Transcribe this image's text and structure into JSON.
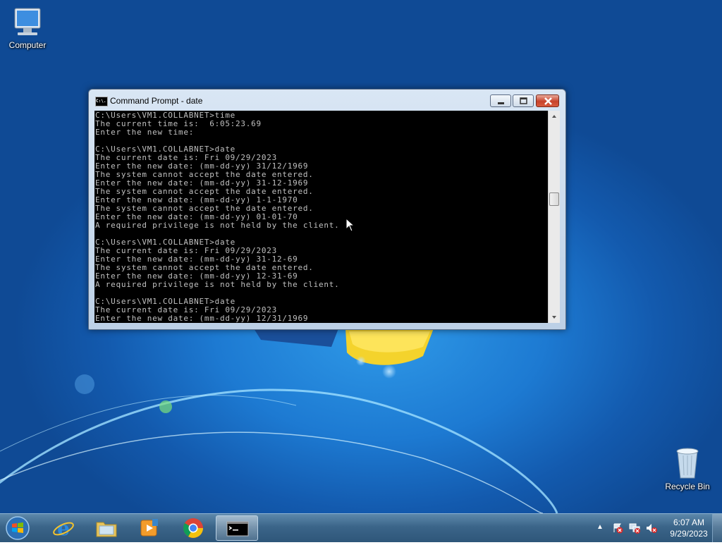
{
  "desktop": {
    "icons": [
      {
        "label": "Computer",
        "icon": "computer-icon"
      },
      {
        "label": "Recycle Bin",
        "icon": "recycle-bin-icon"
      }
    ]
  },
  "window": {
    "title": "Command Prompt - date",
    "icon": "cmd-icon",
    "icon_text": "C:\\.",
    "controls": [
      "minimize",
      "maximize",
      "close"
    ],
    "console_lines": [
      "C:\\Users\\VM1.COLLABNET>time",
      "The current time is:  6:05:23.69",
      "Enter the new time:",
      "",
      "C:\\Users\\VM1.COLLABNET>date",
      "The current date is: Fri 09/29/2023",
      "Enter the new date: (mm-dd-yy) 31/12/1969",
      "The system cannot accept the date entered.",
      "Enter the new date: (mm-dd-yy) 31-12-1969",
      "The system cannot accept the date entered.",
      "Enter the new date: (mm-dd-yy) 1-1-1970",
      "The system cannot accept the date entered.",
      "Enter the new date: (mm-dd-yy) 01-01-70",
      "A required privilege is not held by the client.",
      "",
      "C:\\Users\\VM1.COLLABNET>date",
      "The current date is: Fri 09/29/2023",
      "Enter the new date: (mm-dd-yy) 31-12-69",
      "The system cannot accept the date entered.",
      "Enter the new date: (mm-dd-yy) 12-31-69",
      "A required privilege is not held by the client.",
      "",
      "C:\\Users\\VM1.COLLABNET>date",
      "The current date is: Fri 09/29/2023",
      "Enter the new date: (mm-dd-yy) 12/31/1969"
    ]
  },
  "taskbar": {
    "items": [
      {
        "name": "internet-explorer",
        "icon": "ie-icon"
      },
      {
        "name": "windows-explorer",
        "icon": "folder-icon"
      },
      {
        "name": "media-player",
        "icon": "media-player-icon"
      },
      {
        "name": "google-chrome",
        "icon": "chrome-icon"
      },
      {
        "name": "command-prompt",
        "icon": "cmd-icon",
        "active": true
      }
    ],
    "tray": {
      "icons": [
        "action-center-icon",
        "network-icon",
        "volume-muted-icon"
      ],
      "time": "6:07 AM",
      "date": "9/29/2023"
    }
  },
  "colors": {
    "console_background": "#000000",
    "console_text": "#c0c0c0",
    "desktop_blue": "#1d7ad2",
    "close_button": "#c7432c"
  }
}
